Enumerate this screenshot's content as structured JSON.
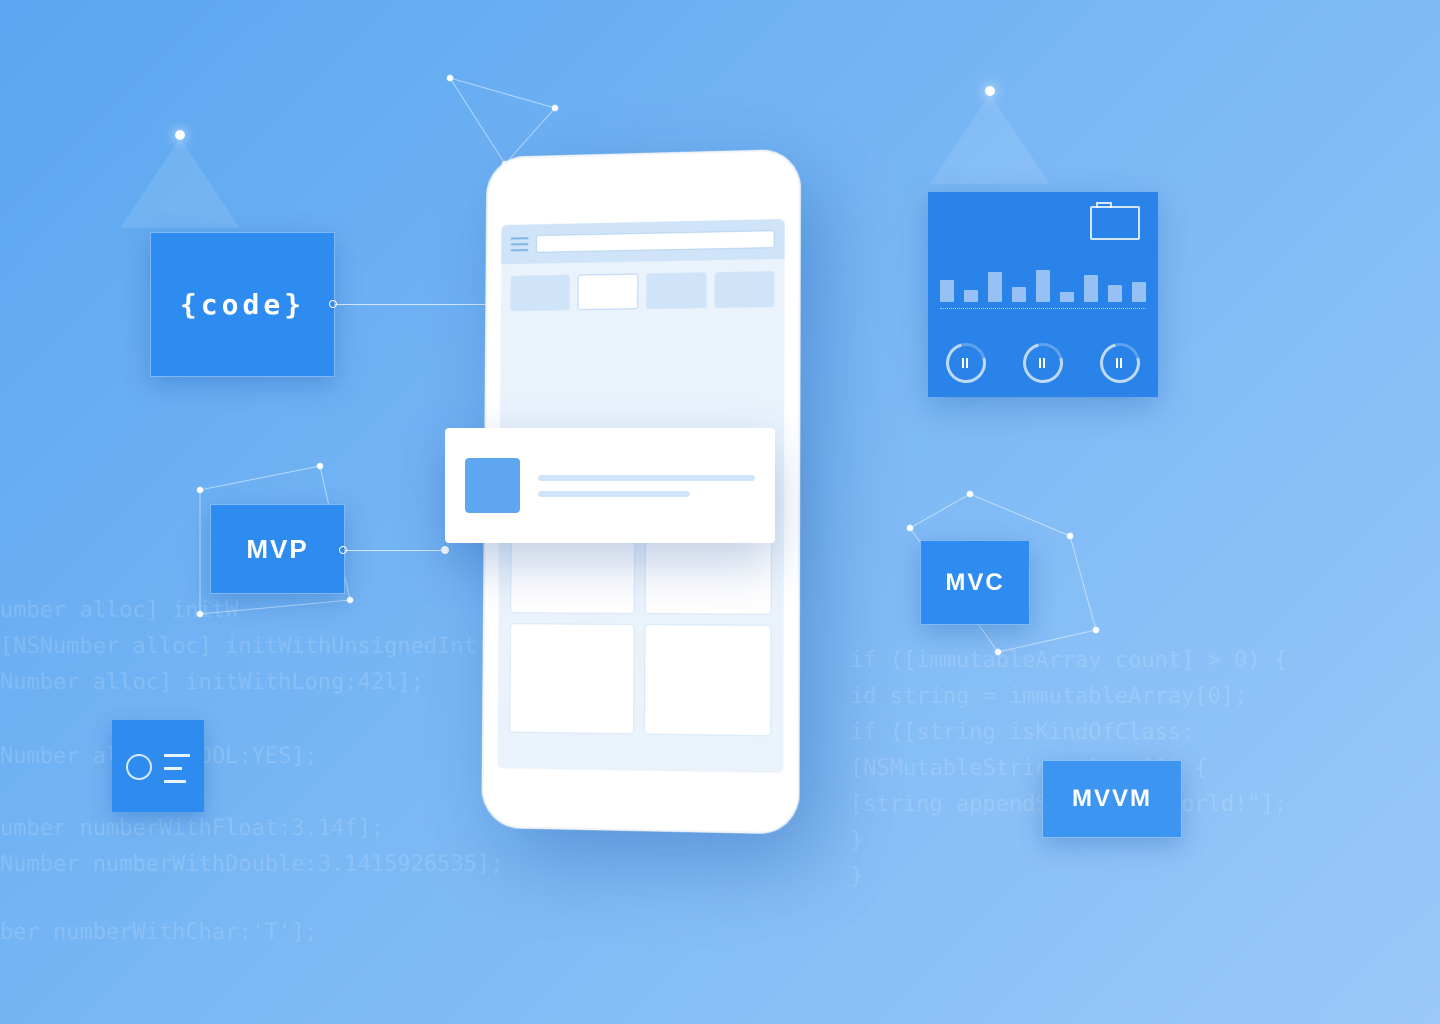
{
  "illustration": {
    "labels": {
      "code": "{code}",
      "mvp": "MVP",
      "mvc": "MVC",
      "mvvm": "MVVM"
    },
    "background_code": {
      "left": [
        "umber alloc] initW",
        "[NSNumber alloc] initWithUnsignedInt:42u];",
        "Number alloc] initWithLong:42l];",
        "Number alloc]          BOOL:YES];",
        "umber numberWithFloat:3.14f];",
        "Number numberWithDouble:3.1415926535];",
        "ber numberWithChar:'T'];"
      ],
      "right": [
        "if ([immutableArray count] > 0) {",
        "id string = immutableArray[0];",
        "if ([string isKindOfClass:",
        "[NSMutableString class]]) {",
        "[string appendString:@\" World!\"];",
        "}",
        "}"
      ]
    },
    "chart_card": {
      "bar_heights_pct": [
        45,
        25,
        60,
        30,
        65,
        20,
        55,
        35,
        40
      ],
      "dials": 3
    }
  }
}
